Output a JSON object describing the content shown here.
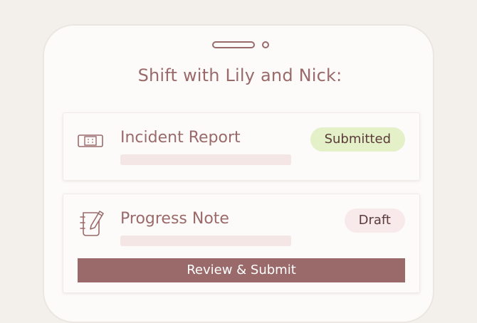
{
  "header": {
    "title": "Shift with Lily and Nick:"
  },
  "cards": [
    {
      "icon": "bandage-icon",
      "title": "Incident Report",
      "status": "Submitted",
      "status_color": "#e3f0c8"
    },
    {
      "icon": "notebook-pen-icon",
      "title": "Progress Note",
      "status": "Draft",
      "status_color": "#f8e9ea",
      "action_label": "Review & Submit"
    }
  ],
  "colors": {
    "accent": "#9a6a6a",
    "background": "#f3f0ec",
    "placeholder": "#f3e6e5"
  }
}
